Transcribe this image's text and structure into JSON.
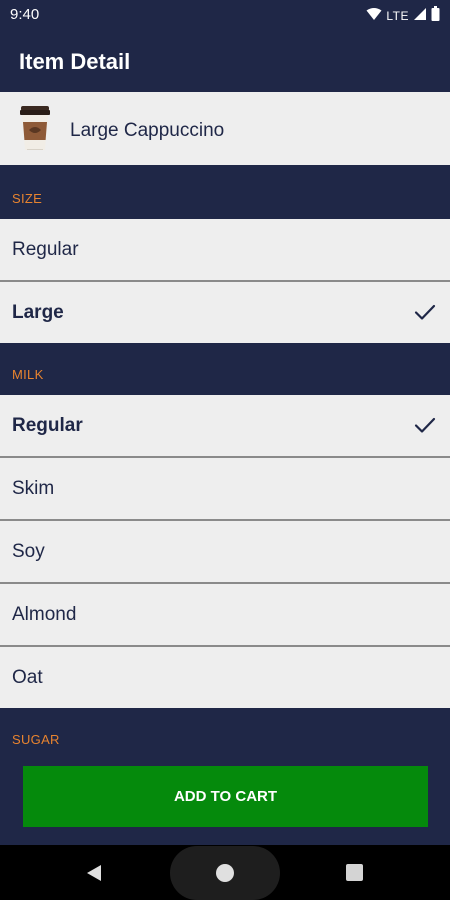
{
  "status_bar": {
    "time": "9:40",
    "network": "LTE",
    "icons": [
      "wifi-icon",
      "signal-icon",
      "battery-icon"
    ]
  },
  "app_bar": {
    "title": "Item Detail"
  },
  "item": {
    "name": "Large Cappuccino",
    "icon": "coffee-cup-icon"
  },
  "sections": {
    "size": {
      "label": "SIZE",
      "options": [
        {
          "label": "Regular",
          "selected": false
        },
        {
          "label": "Large",
          "selected": true
        }
      ]
    },
    "milk": {
      "label": "MILK",
      "options": [
        {
          "label": "Regular",
          "selected": true
        },
        {
          "label": "Skim",
          "selected": false
        },
        {
          "label": "Soy",
          "selected": false
        },
        {
          "label": "Almond",
          "selected": false
        },
        {
          "label": "Oat",
          "selected": false
        }
      ]
    },
    "sugar": {
      "label": "SUGAR"
    }
  },
  "actions": {
    "add_to_cart_label": "ADD TO CART"
  },
  "nav_bar": {
    "icons": [
      "back-icon",
      "home-icon",
      "recents-icon"
    ]
  },
  "colors": {
    "primary_dark": "#1f2747",
    "accent_orange": "#e7832f",
    "list_background": "#eeeeee",
    "button_green": "#058a0c"
  }
}
